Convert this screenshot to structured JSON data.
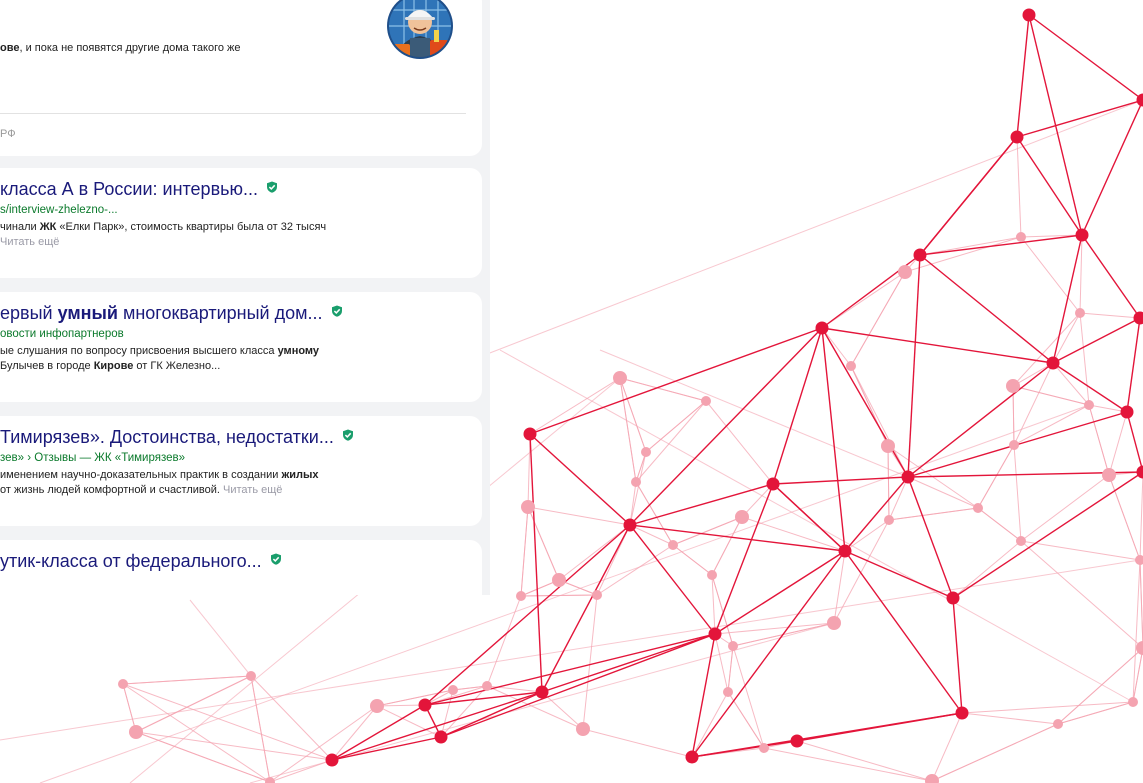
{
  "colors": {
    "page_bg": "#f2f3f5",
    "card_bg": "#ffffff",
    "title": "#1a1a7a",
    "url": "#0b7a2c",
    "more_link": "#9a9aa6",
    "verified_badge": "#1a9e6c",
    "network_dark": "#e3153a",
    "network_light": "#f4a3b0"
  },
  "top_card": {
    "snippet_bold": "ове",
    "snippet_rest": ", и пока не появятся другие дома такого же",
    "source": "РФ",
    "avatar_icon": "construction-worker-avatar-icon"
  },
  "results": [
    {
      "title_parts": [
        {
          "text": "класса А в России: интервью...",
          "bold": false
        }
      ],
      "url": "s/interview-zhelezno-...",
      "lines": [
        [
          {
            "text": "чинали ",
            "bold": false
          },
          {
            "text": "ЖК",
            "bold": true
          },
          {
            "text": " «Елки Парк», стоимость квартиры была от 32 тысяч",
            "bold": false
          }
        ],
        []
      ],
      "more": "Читать ещё",
      "verified_icon": "verified-shield-icon"
    },
    {
      "title_parts": [
        {
          "text": "ервый ",
          "bold": false
        },
        {
          "text": "умный",
          "bold": true
        },
        {
          "text": " многоквартирный дом...",
          "bold": false
        }
      ],
      "url": "овости инфопартнеров",
      "lines": [
        [
          {
            "text": "ые слушания по вопросу присвоения высшего класса ",
            "bold": false
          },
          {
            "text": "умному",
            "bold": true
          }
        ],
        [
          {
            "text": " Булычев в городе ",
            "bold": false
          },
          {
            "text": "Кирове",
            "bold": true
          },
          {
            "text": " от ГК Железно...",
            "bold": false
          }
        ]
      ],
      "more": "",
      "verified_icon": "verified-shield-icon"
    },
    {
      "title_parts": [
        {
          "text": "Тимирязев». Достоинства, недостатки...",
          "bold": false
        }
      ],
      "url": "зев» › Отзывы — ЖК «Тимирязев»",
      "lines": [
        [
          {
            "text": "именением научно-доказательных практик в создании ",
            "bold": false
          },
          {
            "text": "жилых",
            "bold": true
          }
        ],
        [
          {
            "text": "от жизнь людей комфортной и счастливой.",
            "bold": false
          }
        ]
      ],
      "more": "Читать ещё",
      "verified_icon": "verified-shield-icon"
    },
    {
      "title_parts": [
        {
          "text": "утик-класса от федерального...",
          "bold": false
        }
      ],
      "url": "",
      "lines": [],
      "more": "",
      "verified_icon": "verified-shield-icon"
    }
  ]
}
